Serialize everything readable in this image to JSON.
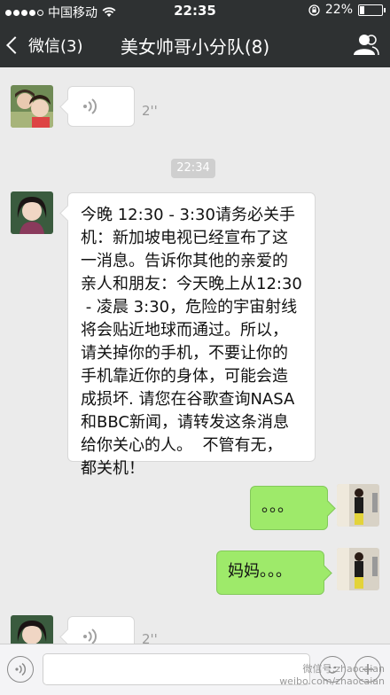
{
  "status_bar": {
    "carrier": "中国移动",
    "time": "22:35",
    "battery": "22%",
    "battery_level": 0.22
  },
  "nav": {
    "back_label": "微信(3)",
    "title": "美女帅哥小分队(8)"
  },
  "messages": {
    "voice1_duration": "2''",
    "timestamp": "22:34",
    "text_msg": "今晚 12:30 - 3:30请务必关手\n机：新加坡电视已经宣布了这\n一消息。告诉你其他的亲爱的\n亲人和朋友：今天晚上从12:30\n - 凌晨 3:30，危险的宇宙射线\n将会贴近地球而通过。所以，\n请关掉你的手机，不要让你的\n手机靠近你的身体，可能会造\n成损坏. 请您在谷歌查询NASA\n和BBC新闻，请转发这条消息\n给你关心的人。  不管有无，\n都关机！",
    "reply1": "。。。",
    "reply2": "妈妈。。。",
    "voice2_duration": "2''"
  },
  "watermark": {
    "line1": "微信号:zhaocaian",
    "line2": "weibo.com/zhaocaian"
  },
  "colors": {
    "nav_bg": "#2e3132",
    "chat_bg": "#ebebeb",
    "bubble_green": "#9eea6a"
  },
  "icons": [
    "signal-dots-icon",
    "wifi-icon",
    "lock-rotation-icon",
    "battery-icon",
    "back-chevron-icon",
    "contacts-icon",
    "voice-wave-icon",
    "voice-input-icon",
    "emoji-icon",
    "plus-icon"
  ]
}
